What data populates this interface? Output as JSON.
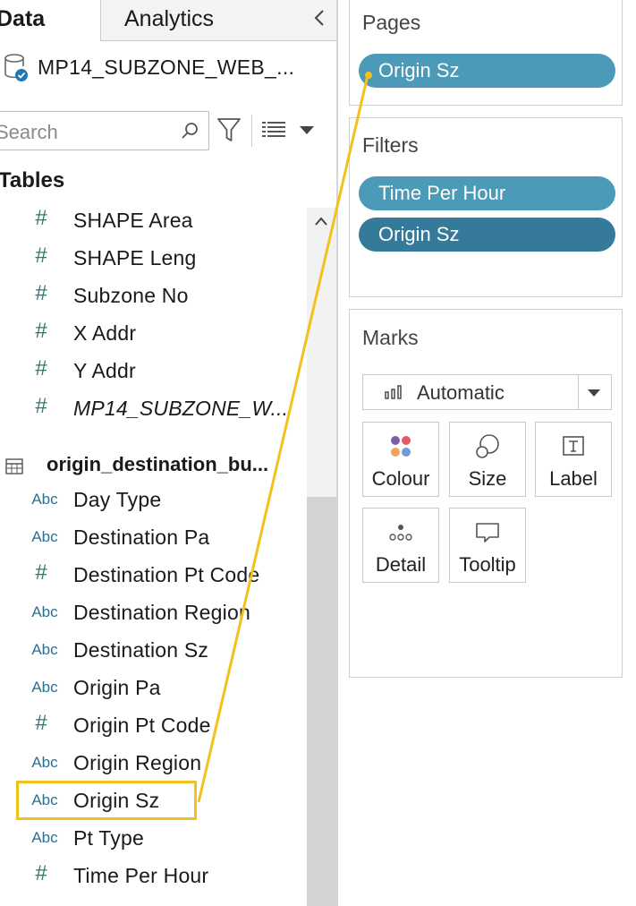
{
  "tabs": {
    "data": "Data",
    "analytics": "Analytics"
  },
  "datasource": {
    "name": "MP14_SUBZONE_WEB_..."
  },
  "search": {
    "placeholder": "Search"
  },
  "tables_heading": "Tables",
  "fields_top": [
    {
      "type": "measure",
      "icon": "#",
      "label": "SHAPE Area"
    },
    {
      "type": "measure",
      "icon": "#",
      "label": "SHAPE Leng"
    },
    {
      "type": "measure",
      "icon": "#",
      "label": "Subzone No"
    },
    {
      "type": "measure",
      "icon": "#",
      "label": "X Addr"
    },
    {
      "type": "measure",
      "icon": "#",
      "label": "Y Addr"
    },
    {
      "type": "measure",
      "icon": "#",
      "label": "MP14_SUBZONE_W...",
      "italic": true
    }
  ],
  "table2": {
    "name": "origin_destination_bu..."
  },
  "fields_bottom": [
    {
      "type": "dimension",
      "icon": "Abc",
      "label": "Day Type"
    },
    {
      "type": "dimension",
      "icon": "Abc",
      "label": "Destination Pa"
    },
    {
      "type": "measure",
      "icon": "#",
      "label": "Destination Pt Code"
    },
    {
      "type": "dimension",
      "icon": "Abc",
      "label": "Destination Region"
    },
    {
      "type": "dimension",
      "icon": "Abc",
      "label": "Destination Sz"
    },
    {
      "type": "dimension",
      "icon": "Abc",
      "label": "Origin Pa"
    },
    {
      "type": "measure",
      "icon": "#",
      "label": "Origin Pt Code"
    },
    {
      "type": "dimension",
      "icon": "Abc",
      "label": "Origin Region"
    },
    {
      "type": "dimension",
      "icon": "Abc",
      "label": "Origin Sz",
      "highlighted": true
    },
    {
      "type": "dimension",
      "icon": "Abc",
      "label": "Pt Type"
    },
    {
      "type": "measure",
      "icon": "#",
      "label": "Time Per Hour"
    }
  ],
  "pages": {
    "title": "Pages",
    "pill": "Origin Sz"
  },
  "filters": {
    "title": "Filters",
    "pills": [
      "Time Per Hour",
      "Origin Sz"
    ]
  },
  "marks": {
    "title": "Marks",
    "type": "Automatic",
    "buttons": [
      "Colour",
      "Size",
      "Label",
      "Detail",
      "Tooltip"
    ]
  },
  "colors": {
    "pill_light": "#4a9ab8",
    "pill_dark": "#357a9b",
    "highlight": "#f2c21a",
    "measure_icon": "#2a7a72",
    "dimension_icon": "#2d6f8e"
  }
}
